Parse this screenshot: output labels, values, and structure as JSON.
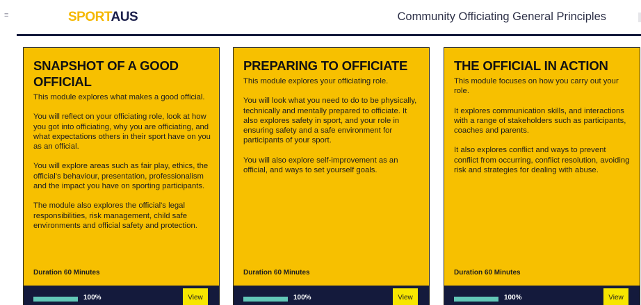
{
  "header": {
    "menu_icon": "menu-icon",
    "logo_part1": "SPORT",
    "logo_part2": "AUS",
    "title": "Community Officiating General Principles"
  },
  "colors": {
    "card_background": "#f7c000",
    "footer_background": "#141a3c",
    "progress_fill": "#62c7b7",
    "view_button": "#f7e600",
    "logo_sport": "#f5b800",
    "logo_aus": "#1b1f4b"
  },
  "cards": [
    {
      "title": "SNAPSHOT OF A GOOD OFFICIAL",
      "paragraphs": [
        "This module explores what makes a good official.",
        "You will reflect on your officiating role, look at how you got into officiating, why you are officiating, and what expectations others in their sport have on you as an official.",
        "You will explore areas such as fair play, ethics, the official's behaviour, presentation, professionalism and the impact you have on sporting participants.",
        "The module also explores the official's legal responsibilities, risk management, child safe environments and official safety and protection."
      ],
      "duration": "Duration 60 Minutes",
      "progress_value": 100,
      "progress_label": "100%",
      "view_label": "View"
    },
    {
      "title": "PREPARING TO OFFICIATE",
      "paragraphs": [
        "This module explores your officiating role.",
        "You will look what you need to do to be physically, technically and mentally prepared to officiate. It also explores safety in sport, and your role in ensuring safety and a safe environment for participants of your sport.",
        "You will also explore self-improvement as an official, and ways to set yourself goals."
      ],
      "duration": "Duration 60 Minutes",
      "progress_value": 100,
      "progress_label": "100%",
      "view_label": "View"
    },
    {
      "title": "THE OFFICIAL IN ACTION",
      "paragraphs": [
        "This module focuses on how you carry out your role.",
        "It explores communication skills, and interactions with a range of stakeholders such as participants, coaches and parents.",
        "It also explores conflict and ways to prevent conflict from occurring, conflict resolution, avoiding risk and strategies for dealing with abuse."
      ],
      "duration": "Duration 60 Minutes",
      "progress_value": 100,
      "progress_label": "100%",
      "view_label": "View"
    }
  ]
}
